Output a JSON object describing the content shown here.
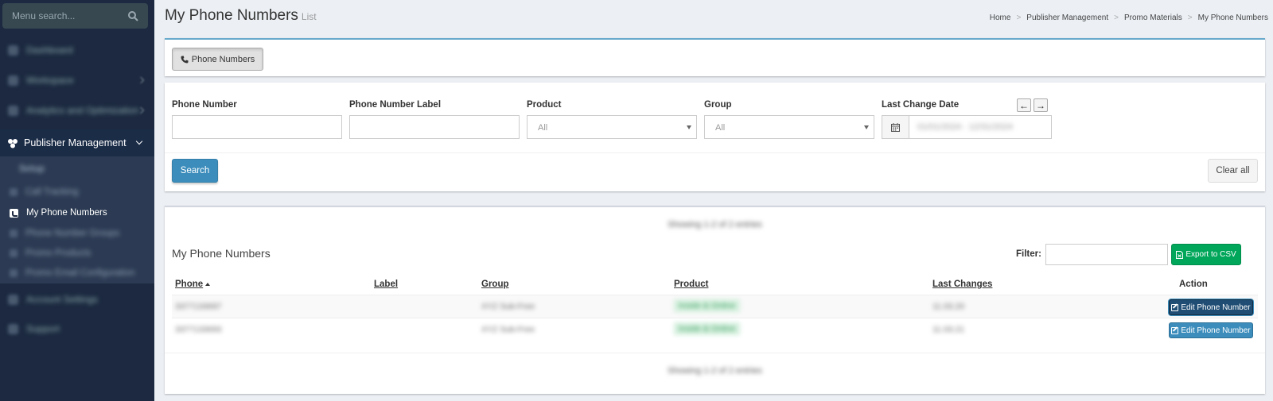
{
  "sidebar": {
    "search_placeholder": "Menu search...",
    "items_top": [
      "Dashboard",
      "Workspace",
      "Analytics and Optimization"
    ],
    "publisher_management": "Publisher Management",
    "submenu_heading": "Setup",
    "submenu_items": [
      "Call Tracking",
      "My Phone Numbers",
      "Phone Number Groups",
      "Promo Products",
      "Promo Email Configuration"
    ],
    "items_bottom": [
      "Account Settings",
      "Support"
    ]
  },
  "header": {
    "title": "My Phone Numbers",
    "subtitle": "List",
    "breadcrumb": [
      "Home",
      "Publisher Management",
      "Promo Materials",
      "My Phone Numbers"
    ]
  },
  "tabs": {
    "phone_numbers": "Phone Numbers"
  },
  "filters": {
    "phone_number_label": "Phone Number",
    "phone_label_label": "Phone Number Label",
    "product_label": "Product",
    "product_value": "All",
    "group_label": "Group",
    "group_value": "All",
    "last_change_label": "Last Change Date",
    "date_range": "01/01/2024 - 12/31/2024",
    "search_button": "Search",
    "clear_button": "Clear all"
  },
  "table": {
    "showing_top": "Showing 1-2 of 2 entries",
    "showing_bottom": "Showing 1-2 of 2 entries",
    "title": "My Phone Numbers",
    "filter_label": "Filter:",
    "export_button": "Export to CSV",
    "columns": [
      "Phone",
      "Label",
      "Group",
      "Product",
      "Last Changes",
      "Action"
    ],
    "rows": [
      {
        "phone": "3377133697",
        "label": "",
        "group": "XYZ Sub-Free",
        "product": "Inside & Online",
        "last_changes": "11.03.20",
        "action": "Edit Phone Number"
      },
      {
        "phone": "3377133693",
        "label": "",
        "group": "XYZ Sub-Free",
        "product": "Inside & Online",
        "last_changes": "11.03.21",
        "action": "Edit Phone Number"
      }
    ]
  }
}
